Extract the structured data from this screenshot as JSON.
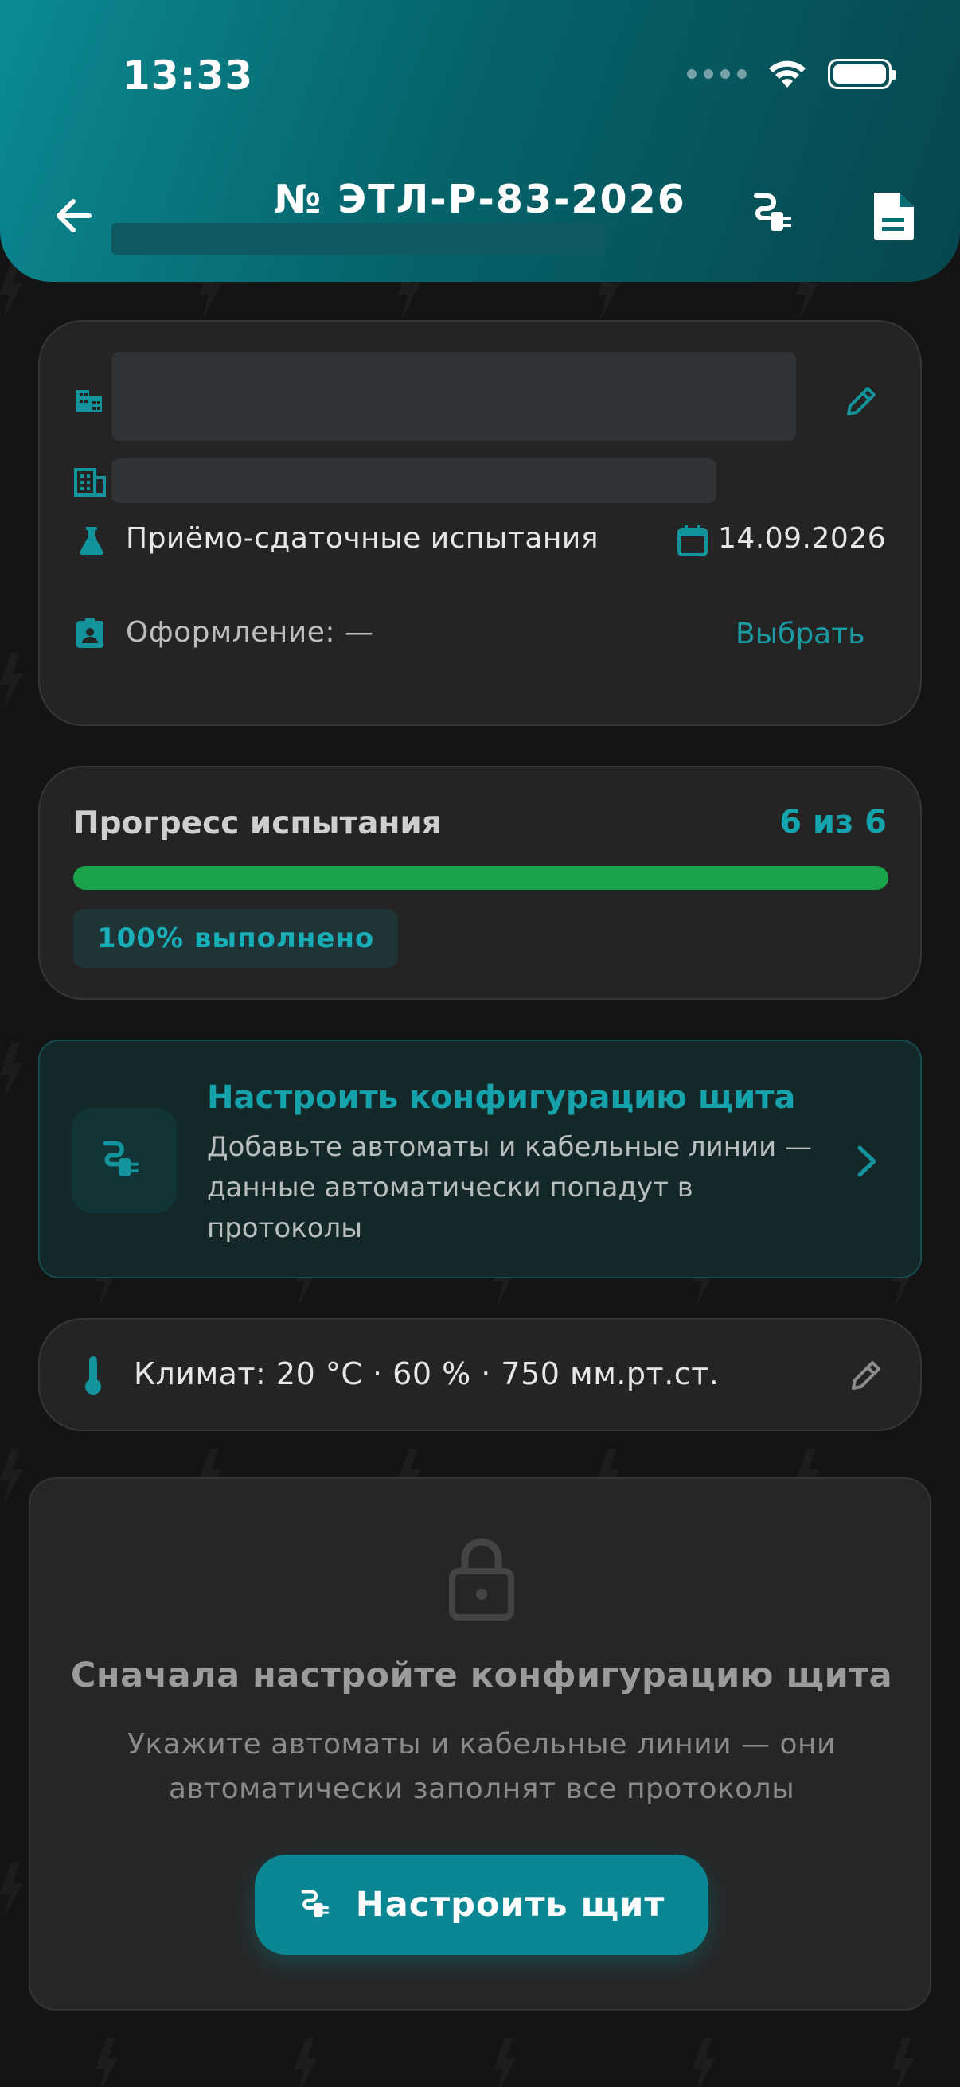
{
  "status_bar": {
    "time": "13:33"
  },
  "header": {
    "title": "№ ЭТЛ-Р-83-2026"
  },
  "info": {
    "test_type": "Приёмо-сдаточные испытания",
    "date": "14.09.2026",
    "registration_label": "Оформление: —",
    "select_link": "Выбрать"
  },
  "progress": {
    "title": "Прогресс испытания",
    "count": "6 из 6",
    "fraction": 1.0,
    "badge": "100% выполнено"
  },
  "config": {
    "title": "Настроить конфигурацию щита",
    "description": "Добавьте автоматы и кабельные линии — данные автоматически попадут в протоколы"
  },
  "climate": {
    "text": "Климат: 20 °C · 60 % · 750 мм.рт.ст."
  },
  "locked": {
    "title": "Сначала настройте конфигурацию щита",
    "description": "Укажите автоматы и кабельные линии — они автоматически заполнят все протоколы",
    "button_label": "Настроить щит"
  },
  "colors": {
    "accent": "#0a8792",
    "progress": "#1aa34a",
    "background": "#141414"
  }
}
